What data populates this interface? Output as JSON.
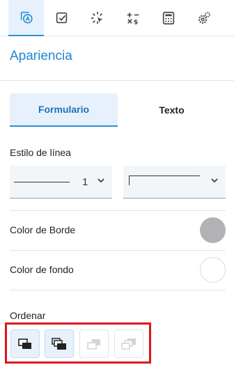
{
  "toolbar": {
    "tools": [
      {
        "icon": "appearance-icon",
        "active": true
      },
      {
        "icon": "checkbox-icon",
        "active": false
      },
      {
        "icon": "click-pointer-icon",
        "active": false
      },
      {
        "icon": "math-operations-icon",
        "active": false
      },
      {
        "icon": "calculator-icon",
        "active": false
      },
      {
        "icon": "settings-gears-icon",
        "active": false
      }
    ]
  },
  "panel": {
    "title": "Apariencia",
    "tabs": [
      {
        "label": "Formulario",
        "active": true
      },
      {
        "label": "Texto",
        "active": false
      }
    ]
  },
  "line_style": {
    "label": "Estilo de línea",
    "width_value": "1"
  },
  "border_color": {
    "label": "Color de Borde",
    "value": "#b2b2b5"
  },
  "fill_color": {
    "label": "Color de fondo",
    "value": "#ffffff"
  },
  "order": {
    "label": "Ordenar",
    "buttons": [
      {
        "icon": "bring-forward-icon",
        "enabled": true
      },
      {
        "icon": "bring-to-front-icon",
        "enabled": true
      },
      {
        "icon": "send-backward-icon",
        "enabled": false
      },
      {
        "icon": "send-to-back-icon",
        "enabled": false
      }
    ]
  },
  "colors": {
    "accent": "#1f86d6",
    "highlight_frame": "#e0141c"
  }
}
